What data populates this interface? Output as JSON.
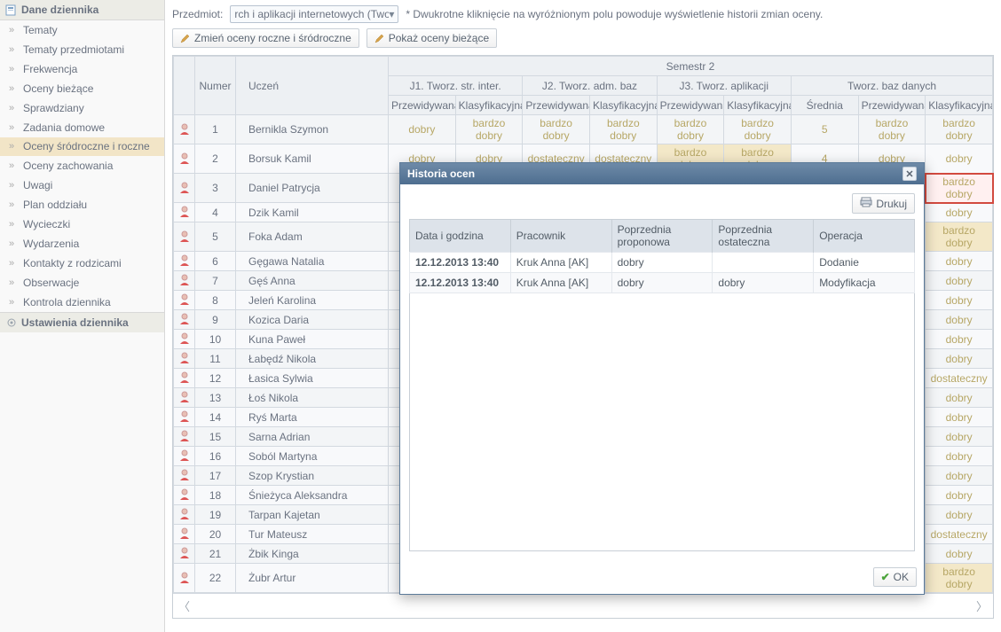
{
  "sidebar": {
    "header": "Dane dziennika",
    "items": [
      {
        "label": "Tematy"
      },
      {
        "label": "Tematy przedmiotami"
      },
      {
        "label": "Frekwencja"
      },
      {
        "label": "Oceny bieżące"
      },
      {
        "label": "Sprawdziany"
      },
      {
        "label": "Zadania domowe"
      },
      {
        "label": "Oceny śródroczne i roczne",
        "active": true,
        "multiline": true
      },
      {
        "label": "Oceny zachowania"
      },
      {
        "label": "Uwagi"
      },
      {
        "label": "Plan oddziału"
      },
      {
        "label": "Wycieczki"
      },
      {
        "label": "Wydarzenia"
      },
      {
        "label": "Kontakty z rodzicami"
      },
      {
        "label": "Obserwacje"
      },
      {
        "label": "Kontrola dziennika"
      }
    ],
    "footer": "Ustawienia dziennika"
  },
  "toolbar": {
    "subject_label": "Przedmiot:",
    "subject_value": "rch i aplikacji internetowych (Tworz.",
    "hint": "* Dwukrotne kliknięcie na wyróżnionym polu powoduje wyświetlenie historii zmian oceny.",
    "btn1": "Zmień oceny roczne i śródroczne",
    "btn2": "Pokaż oceny bieżące"
  },
  "grid": {
    "semester": "Semestr 2",
    "groups": [
      "J1. Tworz. str. inter.",
      "J2. Tworz. adm. baz",
      "J3. Tworz. aplikacji",
      "Tworz. baz danych"
    ],
    "cols": {
      "numer": "Numer",
      "uczen": "Uczeń",
      "przew": "Przewidywana",
      "klas": "Klasyfikacyjna",
      "srednia": "Średnia"
    },
    "rows": [
      {
        "n": "1",
        "name": "Bernikla Szymon",
        "g": [
          "dobry",
          "bardzo dobry",
          "bardzo dobry",
          "bardzo dobry",
          "bardzo dobry",
          "bardzo dobry",
          "5",
          "bardzo dobry",
          "bardzo dobry"
        ]
      },
      {
        "n": "2",
        "name": "Borsuk Kamil",
        "g": [
          "dobry",
          "dobry",
          "dostateczny",
          "dostateczny",
          "bardzo dobry",
          "bardzo dobry",
          "4",
          "dobry",
          "dobry"
        ],
        "high": [
          4,
          5
        ]
      },
      {
        "n": "3",
        "name": "Daniel Patrycja",
        "last": "bardzo dobry",
        "redbox": true
      },
      {
        "n": "4",
        "name": "Dzik Kamil",
        "last": "dobry"
      },
      {
        "n": "5",
        "name": "Foka Adam",
        "last": "bardzo dobry",
        "lasthl": true
      },
      {
        "n": "6",
        "name": "Gęgawa Natalia",
        "last": "dobry"
      },
      {
        "n": "7",
        "name": "Gęś Anna",
        "last": "dobry"
      },
      {
        "n": "8",
        "name": "Jeleń Karolina",
        "last": "dobry"
      },
      {
        "n": "9",
        "name": "Kozica Daria",
        "last": "dobry"
      },
      {
        "n": "10",
        "name": "Kuna Paweł",
        "last": "dobry"
      },
      {
        "n": "11",
        "name": "Łabędź Nikola",
        "last": "dobry"
      },
      {
        "n": "12",
        "name": "Łasica Sylwia",
        "last": "dostateczny"
      },
      {
        "n": "13",
        "name": "Łoś Nikola",
        "last": "dobry"
      },
      {
        "n": "14",
        "name": "Ryś Marta",
        "last": "dobry"
      },
      {
        "n": "15",
        "name": "Sarna Adrian",
        "last": "dobry"
      },
      {
        "n": "16",
        "name": "Soból Martyna",
        "last": "dobry"
      },
      {
        "n": "17",
        "name": "Szop Krystian",
        "last": "dobry"
      },
      {
        "n": "18",
        "name": "Śnieżyca Aleksandra",
        "last": "dobry"
      },
      {
        "n": "19",
        "name": "Tarpan Kajetan",
        "last": "dobry"
      },
      {
        "n": "20",
        "name": "Tur Mateusz",
        "last": "dostateczny"
      },
      {
        "n": "21",
        "name": "Żbik Kinga",
        "last": "dobry"
      },
      {
        "n": "22",
        "name": "Żubr Artur",
        "last": "bardzo dobry",
        "lasthl": true
      }
    ]
  },
  "modal": {
    "title": "Historia ocen",
    "print": "Drukuj",
    "cols": [
      "Data i godzina",
      "Pracownik",
      "Poprzednia proponowa",
      "Poprzednia ostateczna",
      "Operacja"
    ],
    "rows": [
      {
        "c": [
          "12.12.2013 13:40",
          "Kruk Anna [AK]",
          "dobry",
          "",
          "Dodanie"
        ]
      },
      {
        "c": [
          "12.12.2013 13:40",
          "Kruk Anna [AK]",
          "dobry",
          "dobry",
          "Modyfikacja"
        ]
      }
    ],
    "ok": "OK"
  }
}
